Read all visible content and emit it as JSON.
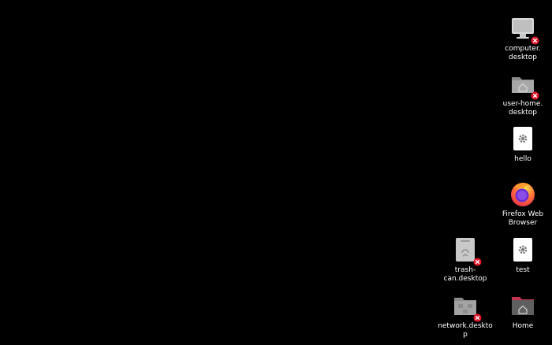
{
  "desktop": {
    "background_color": "#000000",
    "icons": [
      {
        "id": "computer",
        "label": "computer.\ndesktop",
        "icon": "computer-icon",
        "broken": true
      },
      {
        "id": "user-home",
        "label": "user-home.\ndesktop",
        "icon": "folder-home-icon",
        "broken": true
      },
      {
        "id": "hello",
        "label": "hello",
        "icon": "settings-file-icon",
        "broken": false
      },
      {
        "id": "firefox",
        "label": "Firefox Web\nBrowser",
        "icon": "firefox-icon",
        "broken": false
      },
      {
        "id": "trash-can",
        "label": "trash-can.desktop",
        "icon": "trash-icon",
        "broken": true
      },
      {
        "id": "test",
        "label": "test",
        "icon": "settings-file-icon",
        "broken": false
      },
      {
        "id": "network",
        "label": "network.desktop",
        "icon": "network-folder-icon",
        "broken": true
      },
      {
        "id": "home",
        "label": "Home",
        "icon": "home-folder-icon",
        "broken": false
      }
    ]
  },
  "colors": {
    "broken_badge": "#e0162b",
    "home_folder_tab": "#c7334a",
    "firefox_orange": "#ff7139",
    "firefox_purple": "#6a2bd6"
  }
}
